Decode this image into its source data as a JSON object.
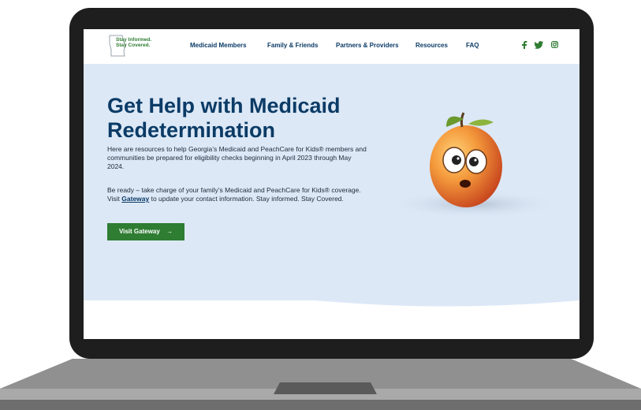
{
  "header": {
    "logo_line1": "Stay Informed.",
    "logo_line2": "Stay Covered.",
    "nav": [
      {
        "label": "Medicaid Members"
      },
      {
        "label": "Family & Friends"
      },
      {
        "label": "Partners & Providers"
      },
      {
        "label": "Resources"
      },
      {
        "label": "FAQ"
      }
    ],
    "social_icons": [
      "facebook-icon",
      "twitter-icon",
      "instagram-icon"
    ]
  },
  "hero": {
    "title_line1": "Get Help with Medicaid",
    "title_line2": "Redetermination",
    "paragraph1": "Here are resources to help Georgia’s Medicaid and PeachCare for Kids® members and communities be prepared for eligibility checks beginning in April 2023 through May 2024.",
    "paragraph2_before": "Be ready – take charge of your family’s Medicaid and PeachCare for Kids® coverage. Visit ",
    "paragraph2_link": "Gateway",
    "paragraph2_after": " to update your contact information. Stay informed. Stay Covered.",
    "button_label": "Visit Gateway",
    "button_icon": "→"
  },
  "colors": {
    "brand_green": "#2e7d32",
    "brand_navy": "#0b3b66",
    "hero_bg": "#dce8f6"
  }
}
